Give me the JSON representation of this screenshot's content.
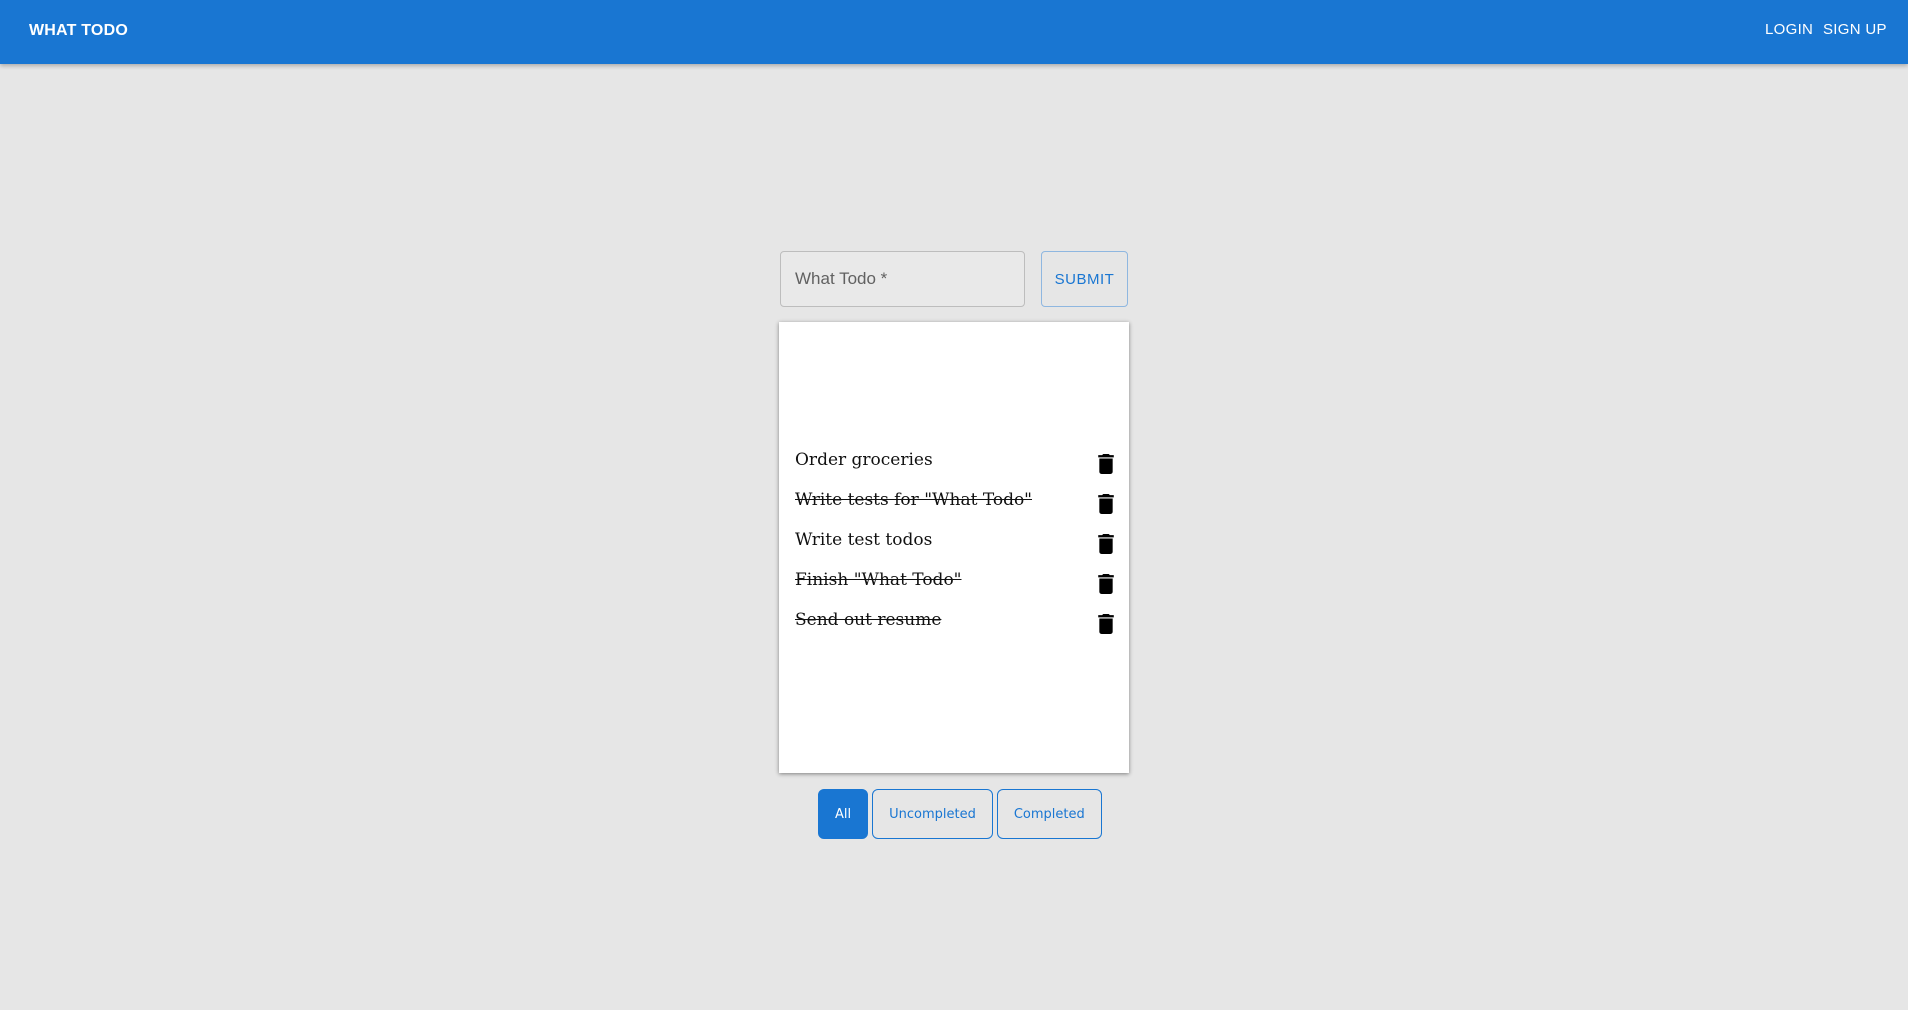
{
  "header": {
    "brand": "WHAT TODO",
    "login_label": "LOGIN",
    "signup_label": "SIGN UP"
  },
  "form": {
    "input_placeholder": "What Todo *",
    "input_value": "",
    "submit_label": "SUBMIT"
  },
  "todos": [
    {
      "text": "Order groceries",
      "completed": false
    },
    {
      "text": "Write tests for \"What Todo\"",
      "completed": true
    },
    {
      "text": "Write test todos",
      "completed": false
    },
    {
      "text": "Finish \"What Todo\"",
      "completed": true
    },
    {
      "text": "Send out resume",
      "completed": true
    }
  ],
  "filters": {
    "all": "All",
    "uncompleted": "Uncompleted",
    "completed": "Completed",
    "active": "all"
  },
  "icons": {
    "delete": "trash-icon"
  },
  "colors": {
    "primary": "#1976d2",
    "background": "#e6e6e6"
  }
}
